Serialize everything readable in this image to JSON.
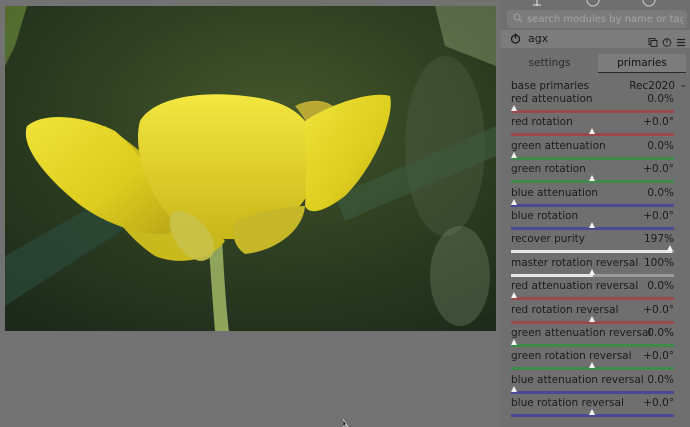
{
  "search": {
    "placeholder": "search modules by name or tag"
  },
  "module": {
    "name": "agx"
  },
  "tabs": [
    {
      "label": "settings",
      "active": false
    },
    {
      "label": "primaries",
      "active": true
    }
  ],
  "base_primaries": {
    "label": "base primaries",
    "value": "Rec2020"
  },
  "sliders": [
    {
      "label": "red attenuation",
      "value": "0.0%",
      "color": "#9a4a4a",
      "pos": 0.0
    },
    {
      "label": "red rotation",
      "value": "+0.0°",
      "color": "#9a4a4a",
      "pos": 0.5
    },
    {
      "label": "green attenuation",
      "value": "0.0%",
      "color": "#3f8a4a",
      "pos": 0.0
    },
    {
      "label": "green rotation",
      "value": "+0.0°",
      "color": "#3f8a4a",
      "pos": 0.5
    },
    {
      "label": "blue attenuation",
      "value": "0.0%",
      "color": "#4a4a94",
      "pos": 0.0
    },
    {
      "label": "blue rotation",
      "value": "+0.0°",
      "color": "#4a4a94",
      "pos": 0.5
    },
    {
      "label": "recover purity",
      "value": "197%",
      "color": "#9a9a9a",
      "pos": 0.985
    },
    {
      "label": "master rotation reversal",
      "value": "100%",
      "color": "#9a9a9a",
      "pos": 0.5
    },
    {
      "label": "red attenuation reversal",
      "value": "0.0%",
      "color": "#9a4a4a",
      "pos": 0.0
    },
    {
      "label": "red rotation reversal",
      "value": "+0.0°",
      "color": "#9a4a4a",
      "pos": 0.5
    },
    {
      "label": "green attenuation reversal",
      "value": "0.0%",
      "color": "#3f8a4a",
      "pos": 0.0
    },
    {
      "label": "green rotation reversal",
      "value": "+0.0°",
      "color": "#3f8a4a",
      "pos": 0.5
    },
    {
      "label": "blue attenuation reversal",
      "value": "0.0%",
      "color": "#4a4a94",
      "pos": 0.0
    },
    {
      "label": "blue rotation reversal",
      "value": "+0.0°",
      "color": "#4a4a94",
      "pos": 0.5
    }
  ]
}
